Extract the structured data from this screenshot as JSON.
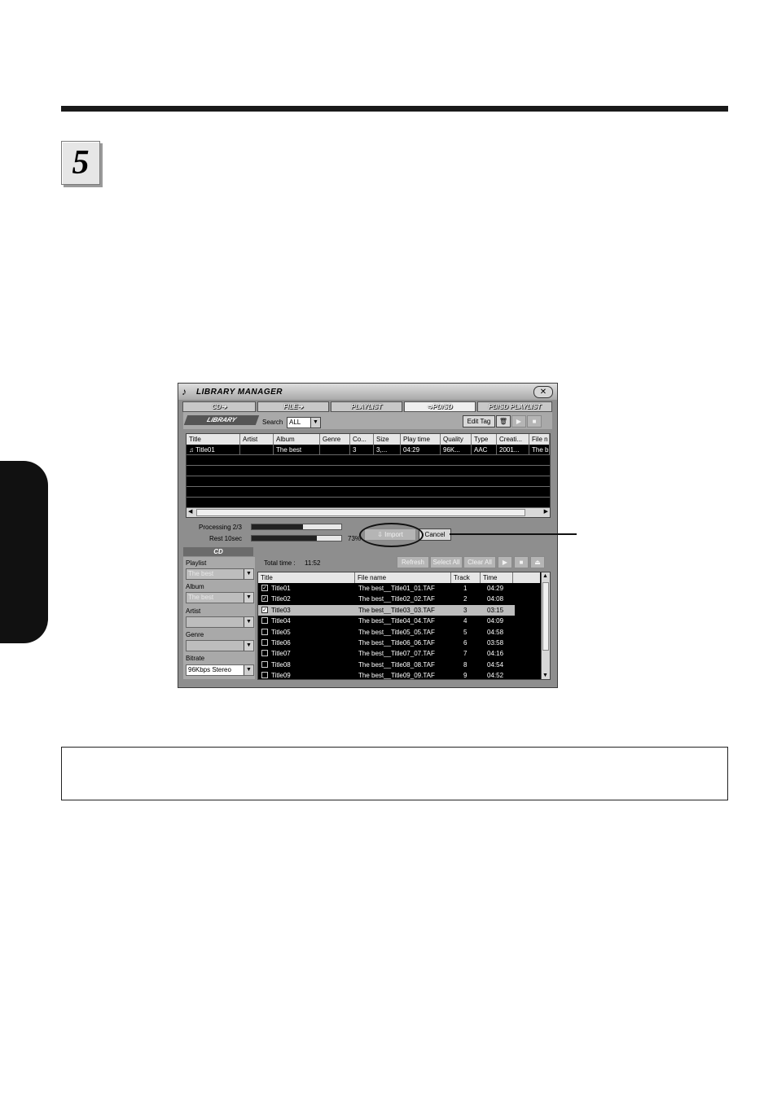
{
  "step": {
    "number": "5"
  },
  "window": {
    "title": "LIBRARY MANAGER",
    "close_icon": "close-icon",
    "app_icon": "note-icon",
    "tabs": [
      {
        "label": "CD➔",
        "active": false
      },
      {
        "label": "FILE➔",
        "active": false
      },
      {
        "label": "PLAYLIST",
        "active": false
      },
      {
        "label": "➩PD/SD",
        "active": true
      },
      {
        "label": "PD/SD PLAYLIST",
        "active": false
      }
    ]
  },
  "library": {
    "label": "LIBRARY",
    "search_label": "Search",
    "search_value": "ALL",
    "edit_tag": "Edit Tag",
    "trash_icon": "trash-icon",
    "play_icon": "play-icon",
    "stop_icon": "stop-icon",
    "columns": [
      "Title",
      "Artist",
      "Album",
      "Genre",
      "Co...",
      "Size",
      "Play time",
      "Quality",
      "Type",
      "Creati...",
      "File n"
    ],
    "rows": [
      [
        "Title01",
        "",
        "The best",
        "",
        "3",
        "3,...",
        "04:29",
        "96K...",
        "AAC",
        "2001...",
        "The b"
      ]
    ]
  },
  "processing": {
    "label": "Processing 2/3",
    "progress": 0.57,
    "rest_label": "Rest 10sec",
    "rest_progress": 0.73,
    "percent": "73%",
    "import_label": "Import",
    "cancel_label": "Cancel"
  },
  "cd": {
    "label": "CD",
    "total_label": "Total time :",
    "total_value": "11:52",
    "refresh": "Refresh",
    "select_all": "Select All",
    "clear_all": "Clear All",
    "playlist_label": "Playlist",
    "playlist_value": "The best",
    "album_label": "Album",
    "album_value": "The best",
    "artist_label": "Artist",
    "genre_label": "Genre",
    "bitrate_label": "Bitrate",
    "bitrate_value": "96Kbps Stereo",
    "columns": [
      "Title",
      "File name",
      "Track",
      "Time"
    ],
    "tracks": [
      {
        "checked": true,
        "title": "Title01",
        "file": "The best__Title01_01.TAF",
        "track": "1",
        "time": "04:29",
        "selected": false
      },
      {
        "checked": true,
        "title": "Title02",
        "file": "The best__Title02_02.TAF",
        "track": "2",
        "time": "04:08",
        "selected": false
      },
      {
        "checked": true,
        "title": "Title03",
        "file": "The best__Title03_03.TAF",
        "track": "3",
        "time": "03:15",
        "selected": true
      },
      {
        "checked": false,
        "title": "Title04",
        "file": "The best__Title04_04.TAF",
        "track": "4",
        "time": "04:09",
        "selected": false
      },
      {
        "checked": false,
        "title": "Title05",
        "file": "The best__Title05_05.TAF",
        "track": "5",
        "time": "04:58",
        "selected": false
      },
      {
        "checked": false,
        "title": "Title06",
        "file": "The best__Title06_06.TAF",
        "track": "6",
        "time": "03:58",
        "selected": false
      },
      {
        "checked": false,
        "title": "Title07",
        "file": "The best__Title07_07.TAF",
        "track": "7",
        "time": "04:16",
        "selected": false
      },
      {
        "checked": false,
        "title": "Title08",
        "file": "The best__Title08_08.TAF",
        "track": "8",
        "time": "04:54",
        "selected": false
      },
      {
        "checked": false,
        "title": "Title09",
        "file": "The best__Title09_09.TAF",
        "track": "9",
        "time": "04:52",
        "selected": false
      }
    ]
  }
}
